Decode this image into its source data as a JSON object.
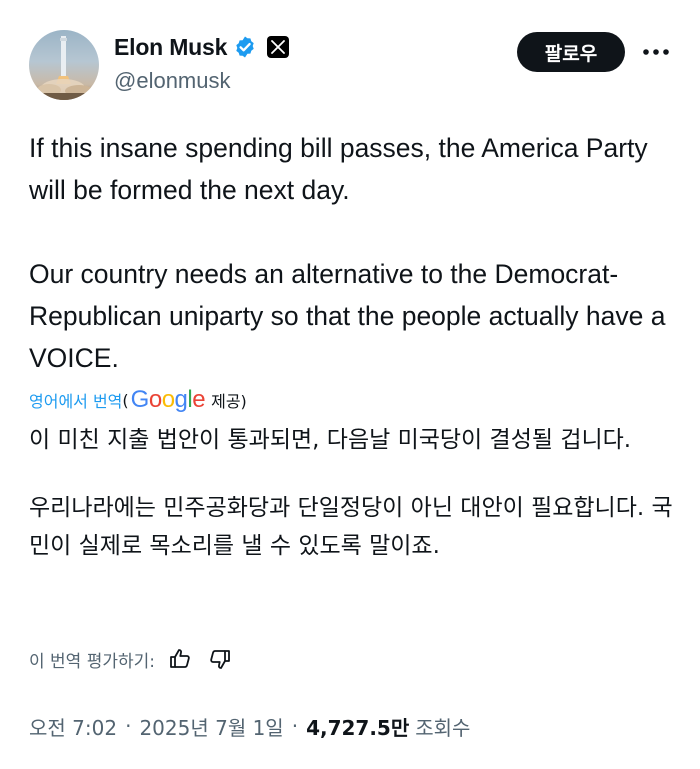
{
  "author": {
    "display_name": "Elon Musk",
    "handle": "@elonmusk",
    "verified": true,
    "affiliate_badge": "x-logo-icon"
  },
  "actions": {
    "follow_label": "팔로우",
    "more_icon": "more-dots-icon"
  },
  "tweet": {
    "paragraphs": [
      "If this insane spending bill passes, the America Party will be formed the next day.",
      "Our country needs an alternative to the Democrat-Republican uniparty so that the people actually have a VOICE."
    ]
  },
  "translation": {
    "source_link": "영어에서 번역",
    "paren_open": "(",
    "provider": "Google",
    "provided_label": "제공)",
    "paragraphs": [
      "이 미친 지출 법안이 통과되면, 다음날 미국당이 결성될 겁니다.",
      "우리나라에는 민주공화당과 단일정당이 아닌 대안이 필요합니다. 국민이 실제로 목소리를 낼 수 있도록 말이죠."
    ],
    "rate_label": "이 번역 평가하기:"
  },
  "meta": {
    "time": "오전 7:02",
    "separator": "·",
    "date": "2025년 7월 1일",
    "views_count": "4,727.5만",
    "views_label": "조회수"
  },
  "colors": {
    "text": "#0f1419",
    "secondary": "#536471",
    "link": "#1d9bf0",
    "verified": "#1d9bf0"
  }
}
